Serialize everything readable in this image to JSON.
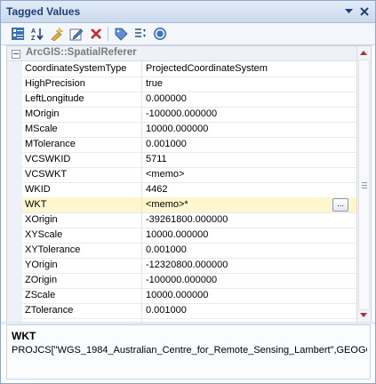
{
  "window": {
    "title": "Tagged Values",
    "dropdown_icon": "chevron-down-icon",
    "close_icon": "close-icon"
  },
  "toolbar": {
    "icons": [
      "categorized-view-icon",
      "sort-alphabetical-icon",
      "add-tag-icon",
      "edit-tag-icon",
      "delete-icon",
      "tag-icon",
      "filter-icon",
      "help-icon"
    ]
  },
  "grid": {
    "category": "ArcGIS::SpatialReferer",
    "rows": [
      {
        "name": "CoordinateSystemType",
        "value": "ProjectedCoordinateSystem"
      },
      {
        "name": "HighPrecision",
        "value": "true"
      },
      {
        "name": "LeftLongitude",
        "value": "0.000000"
      },
      {
        "name": "MOrigin",
        "value": "-100000.000000"
      },
      {
        "name": "MScale",
        "value": "10000.000000"
      },
      {
        "name": "MTolerance",
        "value": "0.001000"
      },
      {
        "name": "VCSWKID",
        "value": "5711"
      },
      {
        "name": "VCSWKT",
        "value": "<memo>"
      },
      {
        "name": "WKID",
        "value": "4462"
      },
      {
        "name": "WKT",
        "value": "<memo>*",
        "selected": true,
        "button": "..."
      },
      {
        "name": "XOrigin",
        "value": "-39261800.000000"
      },
      {
        "name": "XYScale",
        "value": "10000.000000"
      },
      {
        "name": "XYTolerance",
        "value": "0.001000"
      },
      {
        "name": "YOrigin",
        "value": "-12320800.000000"
      },
      {
        "name": "ZOrigin",
        "value": "-100000.000000"
      },
      {
        "name": "ZScale",
        "value": "10000.000000"
      },
      {
        "name": "ZTolerance",
        "value": "0.001000"
      }
    ]
  },
  "description": {
    "title": "WKT",
    "text": "PROJCS[\"WGS_1984_Australian_Centre_for_Remote_Sensing_Lambert\",GEOGC..."
  },
  "colors": {
    "title_text": "#1e3f74",
    "selected_row": "#fdf6cf",
    "scroll_arrow": "#b03030"
  }
}
